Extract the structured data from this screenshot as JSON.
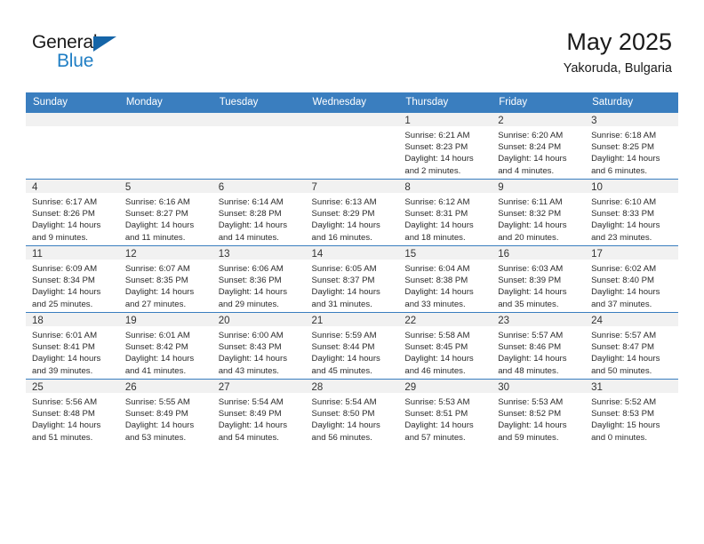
{
  "brand": {
    "name_part1": "General",
    "name_part2": "Blue"
  },
  "header": {
    "title": "May 2025",
    "subtitle": "Yakoruda, Bulgaria"
  },
  "labels": {
    "sunrise_prefix": "Sunrise:",
    "sunset_prefix": "Sunset:",
    "daylight_prefix": "Daylight:"
  },
  "colors": {
    "header_blue": "#3a7ebf",
    "brand_blue": "#1f7ec4",
    "daynum_band": "#f1f1f1"
  },
  "weekdays": [
    "Sunday",
    "Monday",
    "Tuesday",
    "Wednesday",
    "Thursday",
    "Friday",
    "Saturday"
  ],
  "weeks": [
    [
      {
        "empty": true
      },
      {
        "empty": true
      },
      {
        "empty": true
      },
      {
        "empty": true
      },
      {
        "day": "1",
        "sunrise": "Sunrise: 6:21 AM",
        "sunset": "Sunset: 8:23 PM",
        "daylight_line1": "Daylight: 14 hours",
        "daylight_line2": "and 2 minutes."
      },
      {
        "day": "2",
        "sunrise": "Sunrise: 6:20 AM",
        "sunset": "Sunset: 8:24 PM",
        "daylight_line1": "Daylight: 14 hours",
        "daylight_line2": "and 4 minutes."
      },
      {
        "day": "3",
        "sunrise": "Sunrise: 6:18 AM",
        "sunset": "Sunset: 8:25 PM",
        "daylight_line1": "Daylight: 14 hours",
        "daylight_line2": "and 6 minutes."
      }
    ],
    [
      {
        "day": "4",
        "sunrise": "Sunrise: 6:17 AM",
        "sunset": "Sunset: 8:26 PM",
        "daylight_line1": "Daylight: 14 hours",
        "daylight_line2": "and 9 minutes."
      },
      {
        "day": "5",
        "sunrise": "Sunrise: 6:16 AM",
        "sunset": "Sunset: 8:27 PM",
        "daylight_line1": "Daylight: 14 hours",
        "daylight_line2": "and 11 minutes."
      },
      {
        "day": "6",
        "sunrise": "Sunrise: 6:14 AM",
        "sunset": "Sunset: 8:28 PM",
        "daylight_line1": "Daylight: 14 hours",
        "daylight_line2": "and 14 minutes."
      },
      {
        "day": "7",
        "sunrise": "Sunrise: 6:13 AM",
        "sunset": "Sunset: 8:29 PM",
        "daylight_line1": "Daylight: 14 hours",
        "daylight_line2": "and 16 minutes."
      },
      {
        "day": "8",
        "sunrise": "Sunrise: 6:12 AM",
        "sunset": "Sunset: 8:31 PM",
        "daylight_line1": "Daylight: 14 hours",
        "daylight_line2": "and 18 minutes."
      },
      {
        "day": "9",
        "sunrise": "Sunrise: 6:11 AM",
        "sunset": "Sunset: 8:32 PM",
        "daylight_line1": "Daylight: 14 hours",
        "daylight_line2": "and 20 minutes."
      },
      {
        "day": "10",
        "sunrise": "Sunrise: 6:10 AM",
        "sunset": "Sunset: 8:33 PM",
        "daylight_line1": "Daylight: 14 hours",
        "daylight_line2": "and 23 minutes."
      }
    ],
    [
      {
        "day": "11",
        "sunrise": "Sunrise: 6:09 AM",
        "sunset": "Sunset: 8:34 PM",
        "daylight_line1": "Daylight: 14 hours",
        "daylight_line2": "and 25 minutes."
      },
      {
        "day": "12",
        "sunrise": "Sunrise: 6:07 AM",
        "sunset": "Sunset: 8:35 PM",
        "daylight_line1": "Daylight: 14 hours",
        "daylight_line2": "and 27 minutes."
      },
      {
        "day": "13",
        "sunrise": "Sunrise: 6:06 AM",
        "sunset": "Sunset: 8:36 PM",
        "daylight_line1": "Daylight: 14 hours",
        "daylight_line2": "and 29 minutes."
      },
      {
        "day": "14",
        "sunrise": "Sunrise: 6:05 AM",
        "sunset": "Sunset: 8:37 PM",
        "daylight_line1": "Daylight: 14 hours",
        "daylight_line2": "and 31 minutes."
      },
      {
        "day": "15",
        "sunrise": "Sunrise: 6:04 AM",
        "sunset": "Sunset: 8:38 PM",
        "daylight_line1": "Daylight: 14 hours",
        "daylight_line2": "and 33 minutes."
      },
      {
        "day": "16",
        "sunrise": "Sunrise: 6:03 AM",
        "sunset": "Sunset: 8:39 PM",
        "daylight_line1": "Daylight: 14 hours",
        "daylight_line2": "and 35 minutes."
      },
      {
        "day": "17",
        "sunrise": "Sunrise: 6:02 AM",
        "sunset": "Sunset: 8:40 PM",
        "daylight_line1": "Daylight: 14 hours",
        "daylight_line2": "and 37 minutes."
      }
    ],
    [
      {
        "day": "18",
        "sunrise": "Sunrise: 6:01 AM",
        "sunset": "Sunset: 8:41 PM",
        "daylight_line1": "Daylight: 14 hours",
        "daylight_line2": "and 39 minutes."
      },
      {
        "day": "19",
        "sunrise": "Sunrise: 6:01 AM",
        "sunset": "Sunset: 8:42 PM",
        "daylight_line1": "Daylight: 14 hours",
        "daylight_line2": "and 41 minutes."
      },
      {
        "day": "20",
        "sunrise": "Sunrise: 6:00 AM",
        "sunset": "Sunset: 8:43 PM",
        "daylight_line1": "Daylight: 14 hours",
        "daylight_line2": "and 43 minutes."
      },
      {
        "day": "21",
        "sunrise": "Sunrise: 5:59 AM",
        "sunset": "Sunset: 8:44 PM",
        "daylight_line1": "Daylight: 14 hours",
        "daylight_line2": "and 45 minutes."
      },
      {
        "day": "22",
        "sunrise": "Sunrise: 5:58 AM",
        "sunset": "Sunset: 8:45 PM",
        "daylight_line1": "Daylight: 14 hours",
        "daylight_line2": "and 46 minutes."
      },
      {
        "day": "23",
        "sunrise": "Sunrise: 5:57 AM",
        "sunset": "Sunset: 8:46 PM",
        "daylight_line1": "Daylight: 14 hours",
        "daylight_line2": "and 48 minutes."
      },
      {
        "day": "24",
        "sunrise": "Sunrise: 5:57 AM",
        "sunset": "Sunset: 8:47 PM",
        "daylight_line1": "Daylight: 14 hours",
        "daylight_line2": "and 50 minutes."
      }
    ],
    [
      {
        "day": "25",
        "sunrise": "Sunrise: 5:56 AM",
        "sunset": "Sunset: 8:48 PM",
        "daylight_line1": "Daylight: 14 hours",
        "daylight_line2": "and 51 minutes."
      },
      {
        "day": "26",
        "sunrise": "Sunrise: 5:55 AM",
        "sunset": "Sunset: 8:49 PM",
        "daylight_line1": "Daylight: 14 hours",
        "daylight_line2": "and 53 minutes."
      },
      {
        "day": "27",
        "sunrise": "Sunrise: 5:54 AM",
        "sunset": "Sunset: 8:49 PM",
        "daylight_line1": "Daylight: 14 hours",
        "daylight_line2": "and 54 minutes."
      },
      {
        "day": "28",
        "sunrise": "Sunrise: 5:54 AM",
        "sunset": "Sunset: 8:50 PM",
        "daylight_line1": "Daylight: 14 hours",
        "daylight_line2": "and 56 minutes."
      },
      {
        "day": "29",
        "sunrise": "Sunrise: 5:53 AM",
        "sunset": "Sunset: 8:51 PM",
        "daylight_line1": "Daylight: 14 hours",
        "daylight_line2": "and 57 minutes."
      },
      {
        "day": "30",
        "sunrise": "Sunrise: 5:53 AM",
        "sunset": "Sunset: 8:52 PM",
        "daylight_line1": "Daylight: 14 hours",
        "daylight_line2": "and 59 minutes."
      },
      {
        "day": "31",
        "sunrise": "Sunrise: 5:52 AM",
        "sunset": "Sunset: 8:53 PM",
        "daylight_line1": "Daylight: 15 hours",
        "daylight_line2": "and 0 minutes."
      }
    ]
  ]
}
